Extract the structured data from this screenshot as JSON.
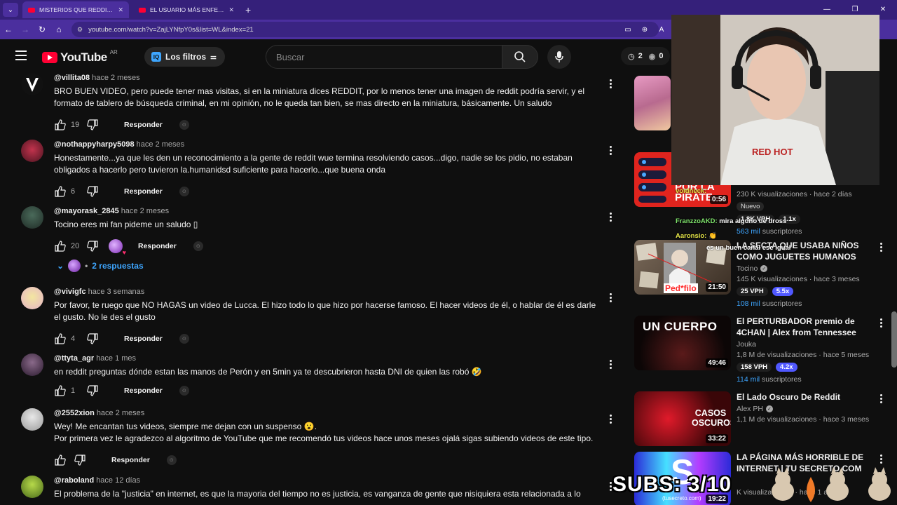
{
  "browser": {
    "tabs": [
      {
        "title": "MISTERIOS QUE REDDIT RESO",
        "active": true
      },
      {
        "title": "EL USUARIO MÁS ENFERMO DE",
        "active": false
      }
    ],
    "url": "youtube.com/watch?v=ZajLYNfpY0s&list=WL&index=21"
  },
  "header": {
    "logo_text": "YouTube",
    "region": "AR",
    "filters_label": "Los filtros",
    "search_placeholder": "Buscar",
    "stats": {
      "clock": "2",
      "eye": "0"
    }
  },
  "comments": [
    {
      "handle": "@villita08",
      "time": "hace 2 meses",
      "text": "BRO BUEN VIDEO, pero puede tener mas visitas, si en la miniatura dices REDDIT, por lo menos tener una imagen de reddit podría servir, y el formato de tablero de búsqueda criminal, en mi opinión, no le queda tan bien, se mas directo en la miniatura, básicamente. Un saludo",
      "likes": "19",
      "reply": "Responder"
    },
    {
      "handle": "@nothappyharpy5098",
      "time": "hace 2 meses",
      "text": "Honestamente...ya que les den un reconocimiento a la gente de reddit wue termina resolviendo casos...digo, nadie se los pidio, no estaban obligados a hacerlo pero tuvieron la.humanidsd suficiente para hacerlo...que buena onda",
      "likes": "6",
      "reply": "Responder"
    },
    {
      "handle": "@mayorask_2845",
      "time": "hace 2 meses",
      "text": "Tocino eres mi fan pideme un saludo ▯",
      "likes": "20",
      "reply": "Responder"
    },
    {
      "handle": "@vivigfc",
      "time": "hace 3 semanas",
      "text": "Por favor, te ruego que NO HAGAS un video de Lucca. El hizo todo lo que hizo por hacerse famoso. El hacer videos de él, o hablar de él es darle el gusto. No le des el gusto",
      "likes": "4",
      "reply": "Responder"
    },
    {
      "handle": "@ttyta_agr",
      "time": "hace 1 mes",
      "text": "en reddit preguntas dónde estan las manos de Perón y en 5min ya te descubrieron hasta DNI de quien las robó 🤣",
      "likes": "1",
      "reply": "Responder"
    },
    {
      "handle": "@2552xion",
      "time": "hace 2 meses",
      "text": "Wey! Me encantan tus videos, siempre me dejan con un suspenso 😮.",
      "text2": "Por primera vez le agradezco al algoritmo de YouTube que me recomendó tus videos hace unos meses ojalá sigas subiendo videos de este tipo.",
      "likes": "",
      "reply": "Responder"
    },
    {
      "handle": "@raboland",
      "time": "hace 12 días",
      "text": "El problema de la \"justicia\" en internet, es que la mayoria del tiempo no es justicia, es vanganza de gente que nisiquiera esta relacionada a lo",
      "likes": "",
      "reply": ""
    }
  ],
  "replies_toggle": "2 respuestas",
  "sidebar": [
    {
      "title": "",
      "channel": "",
      "meta": "230 K visualizaciones · hace 2 días",
      "duration": "0:56",
      "thumb_text": "POR LA PIRATE",
      "badge": "Nuevo",
      "chips": [
        "1.8K VPH",
        "1.1x"
      ],
      "subs_num": "563 mil",
      "subs_label": "suscriptores"
    },
    {
      "title": "LA SECTA QUE USABA NIÑOS COMO JUGUETES HUMANOS",
      "channel": "Tocino",
      "meta": "145 K visualizaciones · hace 3 meses",
      "duration": "21:50",
      "thumb_text": "Ped*filo",
      "chips": [
        "25 VPH",
        "5.5x"
      ],
      "subs_num": "108 mil",
      "subs_label": "suscriptores"
    },
    {
      "title": "El PERTURBADOR premio de 4CHAN | Alex from Tennessee",
      "channel": "Jouka",
      "meta": "1,8 M de visualizaciones · hace 5 meses",
      "duration": "49:46",
      "thumb_text": "UN CUERPO",
      "chips": [
        "158 VPH",
        "4.2x"
      ],
      "subs_num": "114 mil",
      "subs_label": "suscriptores"
    },
    {
      "title": "El Lado Oscuro De Reddit",
      "channel": "Alex PH",
      "meta": "1,1 M de visualizaciones · hace 3 meses",
      "duration": "33:22",
      "thumb_text": "CASOS OSCUROS"
    },
    {
      "title": "LA PÁGINA MÁS HORRIBLE DE INTERNET | TU SECRETO.COM",
      "channel": "",
      "meta": "K visualizaciones · hace 1 año",
      "duration": "19:22",
      "thumb_text": "(tusecreto.com)"
    }
  ],
  "overlay": {
    "chat": [
      {
        "user": "voidneck:",
        "msg": ""
      },
      {
        "user": "FranzzoAKD:",
        "msg": "mira alguno de dross"
      },
      {
        "user": "Aaronsio:",
        "msg": "👏"
      },
      {
        "user": "",
        "msg": "es un buen canal ese igual"
      }
    ],
    "subs_counter": "SUBS: 3/10"
  }
}
